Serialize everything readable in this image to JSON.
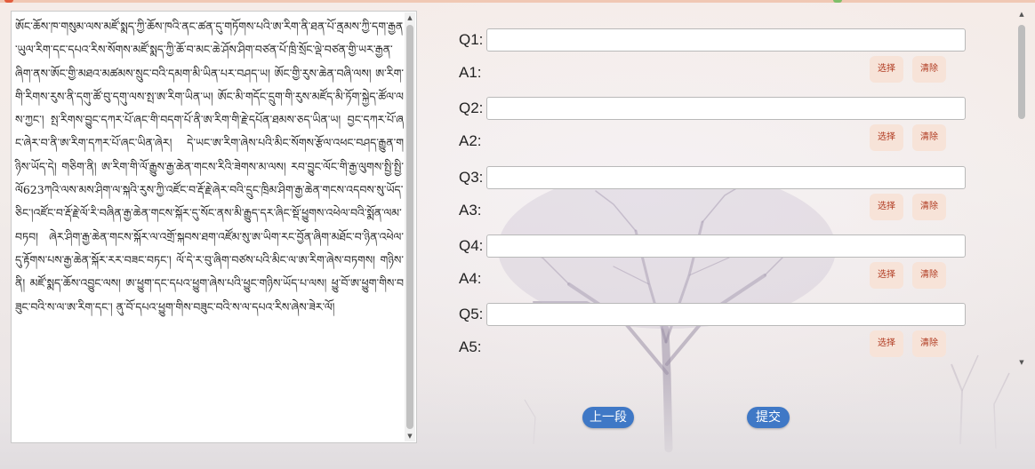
{
  "reading_text": "ཨོང་ཆོས་ཁ་གསུམ་ལས་མཛོ་སྨད་ཀྱི་ཆོས་ཁའི་ནང་ཚན་དུ་གཏོགས་པའི་ཨ་རིག་ནི་ཐན་པོ་ནྲམས་ཀྱི་དག་རྒྱན་ཡུལ་རིག་དང་དཔའ་རིས་སོགས་མཛོ་སྨད་ཀྱི་ཆོ་བ་མང་ཆེ་ཤོས་ཤིག་བཙན་པོ་ཁྲི་སྲོང་ལྡེ་བཙན་གྱི་ཡར་རྒྱན་ཞིག་ནས་ཨོང་གྱི་མཐའ་མཚམས་སྲུང་བའི་དམག་མི་ཡིན་པར་བཤད་ཡ། ཨོང་གྱི་རུས་ཆེན་བཞི་ལས། ཨ་རིག་གི་རིགས་རུས་ནི་དགུ་ཚོ་བུ་དགུ་ལས་སྤ་ཨ་རིག་ཡིན་ཡ། ཨོང་མི་གདོང་དྲུག་གི་རུས་མཛོད་མི་ཏོག་སྐྱེད་ཚོལ་ལས་ཀྱང་། སྤ་རིགས་བྱུང་དཀར་པོ་ཞང་གི་བདག་པོ་ནི་ཨ་རིག་གི་རྗེ་དཔོན་ཐམས་ཅད་ཡིན་ཡ། བྱང་དཀར་པོ་ཞང་ཞེར་བ་ནི་ཨ་རིག་དཀར་པོ་ཞང་ཡིན་ཞེར། དེ་ཡང་ཨ་རིག་ཞེས་པའི་མིང་སོགས་རྩོལ་འཕང་བཤད་རྒྱུན་གཉིས་ཡོད་དེ། གཅིག་ནི། ཨ་རིག་གི་ལོ་རྒྱུས་རྒྱ་ཆེན་གངས་རིའི་ཟེགས་མ་ལས། རབ་བྱུང་ལོང་གི་རྒྱ་ལུགས་སྤྱི་སྤྱི་ལོ623ཀའི་ལས་མས་ཤིག་ལ་སྐའི་རུས་ཀྱི་འཛོང་བ་རྡོ་རྗེ་ཞེར་བའི་དྲུང་ཁྲིམ་ཤིག་རྒྱ་ཆེན་གངས་འདབས་སུ་ཡོད་ཅིང་།འཛོང་བ་རྡོ་རྗེ་ལོ་རི་བཞིན་རྒྱ་ཆེན་གངས་སྐོར་དུ་སོང་ནས་མི་རྒྱུད་དར་ཞིང་སྡོ་ཕྱུགས་འཕེལ་བའི་སྨོན་ལམ་བཏབ། ཞེར་ཤིག་རྒྱ་ཆེན་གངས་སྐོར་ལ་འགྲོ་སྐབས་ཐག་འཛོམ་སུ་ཨ་ཡིག་རང་བྱོན་ཞིག་མཐོང་བ་ཉིན་འཕེལ་དུ་རྟོགས་པས་རྒྱ་ཆེན་སྐོར་རར་བཟང་བཏང་། ལོ་དེ་ར་བུ་ཞིག་བཙས་པའི་མིང་ལ་ཨ་རིག་ཞེས་བཏགས། གཉིས་ནི། མཛོ་སྨད་ཆོས་འབྱུང་ལས། ཨ་ཕྱུག་དང་དཔའ་ཕྱུག་ཞེས་པའི་ཕྱུང་གཉིས་ཡོད་པ་ལས། ཕྱུ་བོ་ཨ་ཕྱུག་གིས་བཟུང་བའི་ས་ལ་ཨ་རིག་དང་། ནུ་བོ་དཔའ་ཕྱུག་གིས་བཟུང་བའི་ས་ལ་དཔའ་རིས་ཞེས་ཟེར་ལོ།",
  "questions": [
    {
      "q_label": "Q1:",
      "a_label": "A1:",
      "q_value": ""
    },
    {
      "q_label": "Q2:",
      "a_label": "A2:",
      "q_value": ""
    },
    {
      "q_label": "Q3:",
      "a_label": "A3:",
      "q_value": ""
    },
    {
      "q_label": "Q4:",
      "a_label": "A4:",
      "q_value": ""
    },
    {
      "q_label": "Q5:",
      "a_label": "A5:",
      "q_value": ""
    }
  ],
  "buttons": {
    "choose": "选择",
    "clear": "清除",
    "prev": "上一段",
    "submit": "提交"
  },
  "colors": {
    "accent_blue": "#3f78c6",
    "small_button_bg": "#f7e3d8",
    "small_button_text": "#b03a20"
  }
}
